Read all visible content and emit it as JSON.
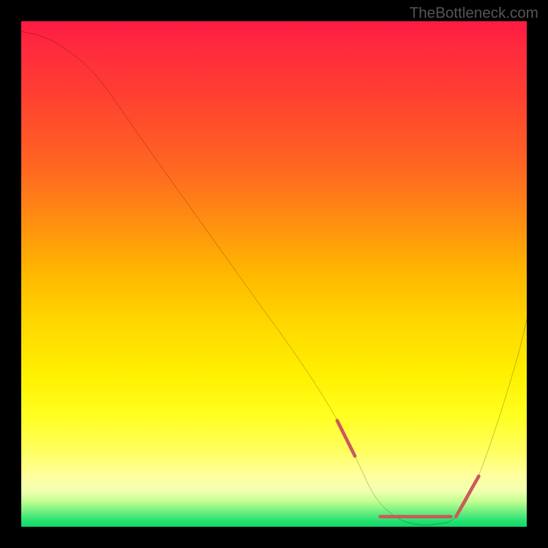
{
  "watermark": "TheBottleneck.com",
  "chart_data": {
    "type": "line",
    "title": "",
    "xlabel": "",
    "ylabel": "",
    "xlim": [
      0,
      100
    ],
    "ylim": [
      0,
      100
    ],
    "series": [
      {
        "name": "curve",
        "color": "#000000",
        "x": [
          0,
          4,
          8,
          15,
          25,
          35,
          45,
          55,
          62,
          66,
          70,
          74,
          78,
          82,
          86,
          90,
          94,
          98,
          100
        ],
        "values": [
          98,
          97,
          95,
          89,
          75,
          61,
          47,
          33,
          22,
          14,
          6,
          2,
          0.5,
          0.5,
          2,
          9,
          20,
          33,
          41
        ]
      }
    ],
    "highlight_segments": [
      {
        "name": "marker-left",
        "color": "#cc5a5a",
        "x_start": 62.5,
        "x_end": 66,
        "y_start": 21,
        "y_end": 14
      },
      {
        "name": "marker-flat",
        "color": "#cc5a5a",
        "x_start": 71,
        "x_end": 85,
        "y_start": 2,
        "y_end": 2
      },
      {
        "name": "marker-right",
        "color": "#cc5a5a",
        "x_start": 86,
        "x_end": 90.5,
        "y_start": 2,
        "y_end": 10
      }
    ]
  }
}
